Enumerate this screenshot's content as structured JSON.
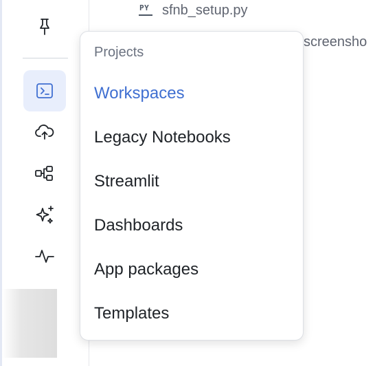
{
  "file_tree": {
    "file_badge": "PY",
    "file_name": "sfnb_setup.py",
    "truncated_item": "screensho"
  },
  "rail": {
    "items": [
      {
        "icon": "pin-icon"
      },
      {
        "icon": "terminal-icon",
        "active": true
      },
      {
        "icon": "cloud-upload-icon"
      },
      {
        "icon": "workflow-icon"
      },
      {
        "icon": "sparkles-icon"
      },
      {
        "icon": "activity-icon"
      }
    ]
  },
  "menu": {
    "header": "Projects",
    "items": [
      {
        "label": "Workspaces",
        "active": true
      },
      {
        "label": "Legacy Notebooks"
      },
      {
        "label": "Streamlit"
      },
      {
        "label": "Dashboards"
      },
      {
        "label": "App packages"
      },
      {
        "label": "Templates"
      }
    ]
  },
  "colors": {
    "accent": "#3f6fd1",
    "active_bg": "#e8eefc",
    "text": "#1f2328",
    "muted": "#6b7280"
  }
}
